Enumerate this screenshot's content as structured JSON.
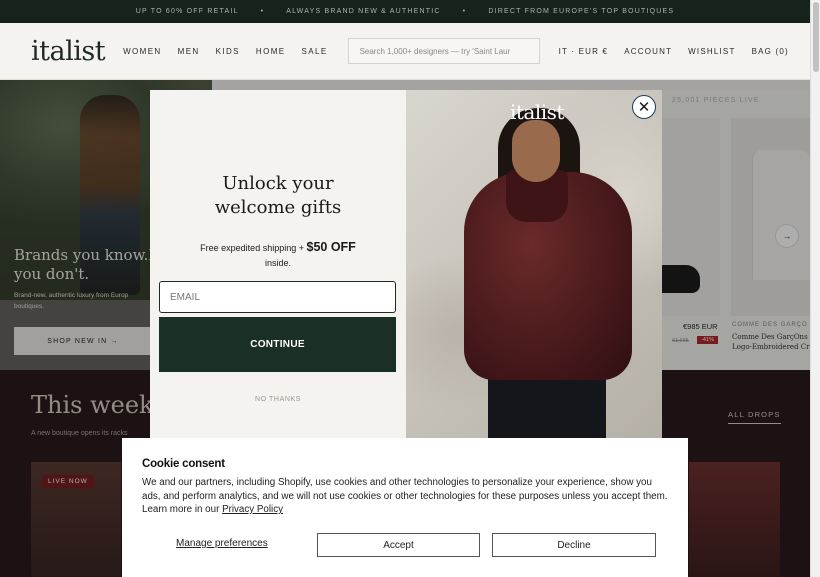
{
  "announcement": {
    "items": [
      "UP TO 60% OFF RETAIL",
      "ALWAYS BRAND NEW & AUTHENTIC",
      "DIRECT FROM EUROPE'S TOP BOUTIQUES"
    ],
    "separator": "•"
  },
  "header": {
    "logo": "italist",
    "nav": [
      "WOMEN",
      "MEN",
      "KIDS",
      "HOME",
      "SALE"
    ],
    "search_placeholder": "Search 1,000+ designers — try 'Saint Laur",
    "locale": "IT · EUR €",
    "account": "ACCOUNT",
    "wishlist": "WISHLIST",
    "bag": "BAG (0)"
  },
  "hero": {
    "title_line1": "Brands you know.Pr",
    "title_line2": "you don't.",
    "subtitle_line1": "Brand-new, authentic luxury from Europ",
    "subtitle_line2": "boutiques.",
    "button": "SHOP NEW IN →"
  },
  "products": {
    "pieces_live": "25,001 PIECES LIVE",
    "item1_price": "€985 EUR",
    "item1_old_price": "€1,665",
    "item1_discount": "-41%",
    "item2_brand": "COMME DES GARÇO",
    "item2_name_line1": "Comme Des GarçOns",
    "item2_name_line2": "Logo-Embroidered Cr",
    "next_arrow": "→"
  },
  "drops": {
    "title": "This week's",
    "subtitle": "A new boutique opens its racks",
    "all_drops": "ALL DROPS",
    "live_now": "LIVE NOW"
  },
  "modal": {
    "logo": "italist",
    "headline_line1": "Unlock your",
    "headline_line2": "welcome gifts",
    "shipping_text": "Free expedited shipping +",
    "offer": "$50 OFF",
    "shipping_suffix": "inside.",
    "email_placeholder": "EMAIL",
    "continue": "CONTINUE",
    "no_thanks": "NO THANKS",
    "close_icon": "close-icon"
  },
  "cookie": {
    "title": "Cookie consent",
    "body": "We and our partners, including Shopify, use cookies and other technologies to personalize your experience, show you ads, and perform analytics, and we will not use cookies or other technologies for these purposes unless you accept them. Learn more in our",
    "privacy_link": "Privacy Policy",
    "manage": "Manage preferences",
    "accept": "Accept",
    "decline": "Decline"
  },
  "colors": {
    "brand_dark_green": "#1a3025",
    "announcement_bg": "#15231c",
    "section_bg": "#2c1b1c",
    "discount_red": "#b1282c"
  }
}
